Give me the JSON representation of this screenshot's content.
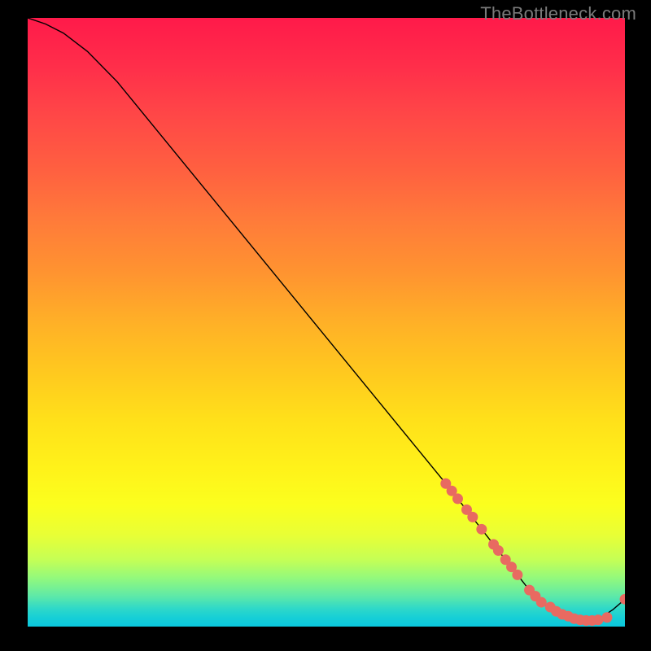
{
  "watermark": "TheBottleneck.com",
  "colors": {
    "background": "#000000",
    "marker": "#e86a61",
    "line": "#000000",
    "watermark_text": "#7a7a7a"
  },
  "chart_data": {
    "type": "line",
    "title": "",
    "xlabel": "",
    "ylabel": "",
    "xlim": [
      0,
      100
    ],
    "ylim": [
      0,
      100
    ],
    "grid": false,
    "legend": false,
    "series": [
      {
        "name": "curve",
        "x": [
          0,
          3,
          6,
          10,
          15,
          20,
          25,
          30,
          35,
          40,
          45,
          50,
          55,
          60,
          65,
          70,
          72,
          74,
          76,
          78,
          80,
          82,
          84,
          86,
          88,
          90,
          92,
          94,
          96,
          98,
          100
        ],
        "y": [
          100,
          99,
          97.5,
          94.5,
          89.5,
          83.5,
          77.5,
          71.5,
          65.5,
          59.5,
          53.5,
          47.5,
          41.5,
          35.5,
          29.5,
          23.5,
          21,
          18.5,
          16,
          13.5,
          11,
          8.5,
          6,
          4,
          2.5,
          1.5,
          1,
          1,
          1.5,
          2.8,
          4.5
        ]
      }
    ],
    "markers": {
      "name": "highlight-points",
      "x": [
        70,
        71,
        72,
        73.5,
        74.5,
        76,
        78,
        78.8,
        80,
        81,
        82,
        84,
        85,
        86,
        87.5,
        88.5,
        89.5,
        90.5,
        91.5,
        92.5,
        93.5,
        94.5,
        95.5,
        97,
        100
      ],
      "y": [
        23.5,
        22.3,
        21,
        19.2,
        18,
        16,
        13.5,
        12.5,
        11,
        9.8,
        8.5,
        6,
        5,
        4,
        3.2,
        2.5,
        2,
        1.7,
        1.3,
        1.1,
        1,
        1,
        1.1,
        1.5,
        4.5
      ]
    }
  }
}
